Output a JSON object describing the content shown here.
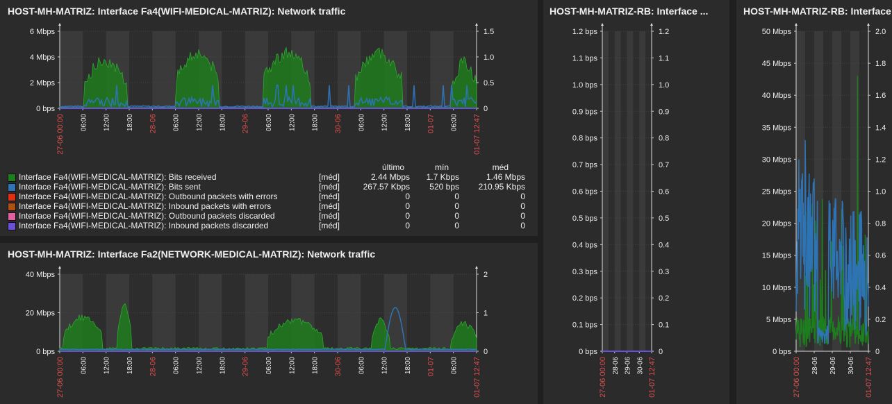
{
  "colors": {
    "bits_received": "#1e7d1e",
    "bits_sent": "#2e74b5",
    "outbound_errors": "#e03010",
    "inbound_errors": "#b05010",
    "outbound_discarded": "#e060a0",
    "inbound_discarded": "#6a50d8",
    "date_label": "#e05050"
  },
  "panels": [
    {
      "title": "HOST-MH-MATRIZ: Interface Fa4(WIFI-MEDICAL-MATRIZ): Network traffic",
      "yleft": [
        "6 Mbps",
        "4 Mbps",
        "2 Mbps",
        "0 bps"
      ],
      "yright": [
        "1.5",
        "1.0",
        "0.5",
        "0"
      ],
      "xticks": [
        {
          "t": "27-06 00:00",
          "red": true
        },
        {
          "t": "06:00"
        },
        {
          "t": "12:00"
        },
        {
          "t": "18:00"
        },
        {
          "t": "28-06",
          "red": true
        },
        {
          "t": "06:00"
        },
        {
          "t": "12:00"
        },
        {
          "t": "18:00"
        },
        {
          "t": "29-06",
          "red": true
        },
        {
          "t": "06:00"
        },
        {
          "t": "12:00"
        },
        {
          "t": "18:00"
        },
        {
          "t": "30-06",
          "red": true
        },
        {
          "t": "06:00"
        },
        {
          "t": "12:00"
        },
        {
          "t": "18:00"
        },
        {
          "t": "01-07",
          "red": true
        },
        {
          "t": "06:00"
        },
        {
          "t": "01-07 12:47",
          "red": true
        }
      ],
      "legend": {
        "headers": [
          "último",
          "mín",
          "méd"
        ],
        "rows": [
          {
            "color_key": "bits_received",
            "label": "Interface Fa4(WIFI-MEDICAL-MATRIZ): Bits received",
            "func": "[méd]",
            "last": "2.44 Mbps",
            "min": "1.7 Kbps",
            "avg": "1.46 Mbps"
          },
          {
            "color_key": "bits_sent",
            "label": "Interface Fa4(WIFI-MEDICAL-MATRIZ): Bits sent",
            "func": "[méd]",
            "last": "267.57 Kbps",
            "min": "520 bps",
            "avg": "210.95 Kbps"
          },
          {
            "color_key": "outbound_errors",
            "label": "Interface Fa4(WIFI-MEDICAL-MATRIZ): Outbound packets with errors",
            "func": "[méd]",
            "last": "0",
            "min": "0",
            "avg": "0"
          },
          {
            "color_key": "inbound_errors",
            "label": "Interface Fa4(WIFI-MEDICAL-MATRIZ): Inbound packets with errors",
            "func": "[méd]",
            "last": "0",
            "min": "0",
            "avg": "0"
          },
          {
            "color_key": "outbound_discarded",
            "label": "Interface Fa4(WIFI-MEDICAL-MATRIZ): Outbound packets discarded",
            "func": "[méd]",
            "last": "0",
            "min": "0",
            "avg": "0"
          },
          {
            "color_key": "inbound_discarded",
            "label": "Interface Fa4(WIFI-MEDICAL-MATRIZ): Inbound packets discarded",
            "func": "[méd]",
            "last": "0",
            "min": "0",
            "avg": "0"
          }
        ]
      }
    },
    {
      "title": "HOST-MH-MATRIZ: Interface Fa2(NETWORK-MEDICAL-MATRIZ): Network traffic",
      "yleft": [
        "40 Mbps",
        "20 Mbps",
        "0 bps"
      ],
      "yright": [
        "2",
        "1",
        "0"
      ],
      "xticks": [
        {
          "t": "27-06 00:00",
          "red": true
        },
        {
          "t": "06:00"
        },
        {
          "t": "12:00"
        },
        {
          "t": "18:00"
        },
        {
          "t": "28-06",
          "red": true
        },
        {
          "t": "06:00"
        },
        {
          "t": "12:00"
        },
        {
          "t": "18:00"
        },
        {
          "t": "29-06",
          "red": true
        },
        {
          "t": "06:00"
        },
        {
          "t": "12:00"
        },
        {
          "t": "18:00"
        },
        {
          "t": "30-06",
          "red": true
        },
        {
          "t": "06:00"
        },
        {
          "t": "12:00"
        },
        {
          "t": "18:00"
        },
        {
          "t": "01-07",
          "red": true
        },
        {
          "t": "06:00"
        },
        {
          "t": "01-07 12:47",
          "red": true
        }
      ]
    },
    {
      "title": "HOST-MH-MATRIZ-RB: Interface ...",
      "yleft": [
        "1.2 bps",
        "1.1 bps",
        "1.0 bps",
        "0.9 bps",
        "0.8 bps",
        "0.7 bps",
        "0.6 bps",
        "0.5 bps",
        "0.4 bps",
        "0.3 bps",
        "0.2 bps",
        "0.1 bps",
        "0 bps"
      ],
      "yright": [
        "1.2",
        "1.1",
        "1.0",
        "0.9",
        "0.8",
        "0.7",
        "0.6",
        "0.5",
        "0.4",
        "0.3",
        "0.2",
        "0.1",
        "0"
      ],
      "xticks": [
        {
          "t": "27-06 00:00",
          "red": true
        },
        {
          "t": "28-06"
        },
        {
          "t": "29-06"
        },
        {
          "t": "30-06"
        },
        {
          "t": "01-07 12:47",
          "red": true
        }
      ]
    },
    {
      "title": "HOST-MH-MATRIZ-RB: Interface",
      "yleft": [
        "50 Mbps",
        "45 Mbps",
        "40 Mbps",
        "35 Mbps",
        "30 Mbps",
        "25 Mbps",
        "20 Mbps",
        "15 Mbps",
        "10 Mbps",
        "5 Mbps",
        "0 bps"
      ],
      "yright": [
        "2.0",
        "1.8",
        "1.6",
        "1.4",
        "1.2",
        "1.0",
        "0.8",
        "0.6",
        "0.4",
        "0.2",
        "0"
      ],
      "xticks": [
        {
          "t": "27-06 00:00",
          "red": true
        },
        {
          "t": "28-06"
        },
        {
          "t": "29-06"
        },
        {
          "t": "30-06"
        },
        {
          "t": "01-07 12:47",
          "red": true
        }
      ]
    }
  ]
}
